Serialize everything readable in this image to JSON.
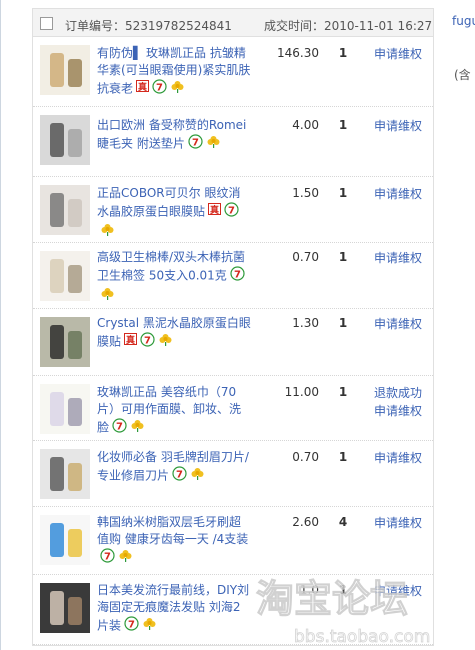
{
  "order": {
    "order_no_label": "订单编号：52319782524841",
    "deal_time_label": "成交时间：2010-11-01 16:27"
  },
  "side": {
    "top_link": "fugu",
    "note": "(含"
  },
  "items": [
    {
      "title": "有防伪▌ 玫琳凯正品 抗皱精华素(可当眼霜使用)紧实肌肤抗衰老",
      "price": "146.30",
      "qty": "1",
      "actions": [
        "申请维权"
      ],
      "tags": [
        "bao",
        "seven",
        "flower"
      ]
    },
    {
      "title": "出口欧洲 备受称赞的Romei睫毛夹 附送垫片",
      "price": "4.00",
      "qty": "1",
      "actions": [
        "申请维权"
      ],
      "tags": [
        "seven",
        "flower"
      ]
    },
    {
      "title": "正品COBOR可贝尔 眼纹消水晶胶原蛋白眼膜贴",
      "price": "1.50",
      "qty": "1",
      "actions": [
        "申请维权"
      ],
      "tags": [
        "bao",
        "seven",
        "flower"
      ]
    },
    {
      "title": "高级卫生棉棒/双头木棒抗菌卫生棉签 50支入0.01克",
      "price": "0.70",
      "qty": "1",
      "actions": [
        "申请维权"
      ],
      "tags": [
        "seven",
        "flower"
      ]
    },
    {
      "title": "Crystal 黑泥水晶胶原蛋白眼膜贴",
      "price": "1.30",
      "qty": "1",
      "actions": [
        "申请维权"
      ],
      "tags": [
        "bao",
        "seven",
        "flower"
      ]
    },
    {
      "title": "玫琳凯正品 美容纸巾（70片）可用作面膜、卸妆、洗脸",
      "price": "11.00",
      "qty": "1",
      "actions": [
        "退款成功",
        "申请维权"
      ],
      "tags": [
        "seven",
        "flower"
      ]
    },
    {
      "title": "化妆师必备 羽毛牌刮眉刀片/专业修眉刀片",
      "price": "0.70",
      "qty": "1",
      "actions": [
        "申请维权"
      ],
      "tags": [
        "seven",
        "flower"
      ]
    },
    {
      "title": "韩国纳米树脂双层毛牙刷超值购 健康牙齿每一天 /4支装",
      "price": "2.60",
      "qty": "4",
      "actions": [
        "申请维权"
      ],
      "tags": [
        "seven",
        "flower"
      ]
    },
    {
      "title": "日本美发流行最前线，DIY刘海固定无痕魔法发贴 刘海2片装",
      "price": "1.0",
      "qty": "1",
      "actions": [
        "申请维权"
      ],
      "tags": [
        "seven",
        "flower"
      ]
    }
  ],
  "watermark": {
    "brand": "淘宝论坛",
    "url": "bbs.taobao.com"
  },
  "colors": {
    "link": "#3c63b5",
    "header_bg": "#f3f3f3",
    "tag_red": "#d4281d",
    "tag_green": "#2e9a3a",
    "tag_yellow": "#f0c020"
  }
}
